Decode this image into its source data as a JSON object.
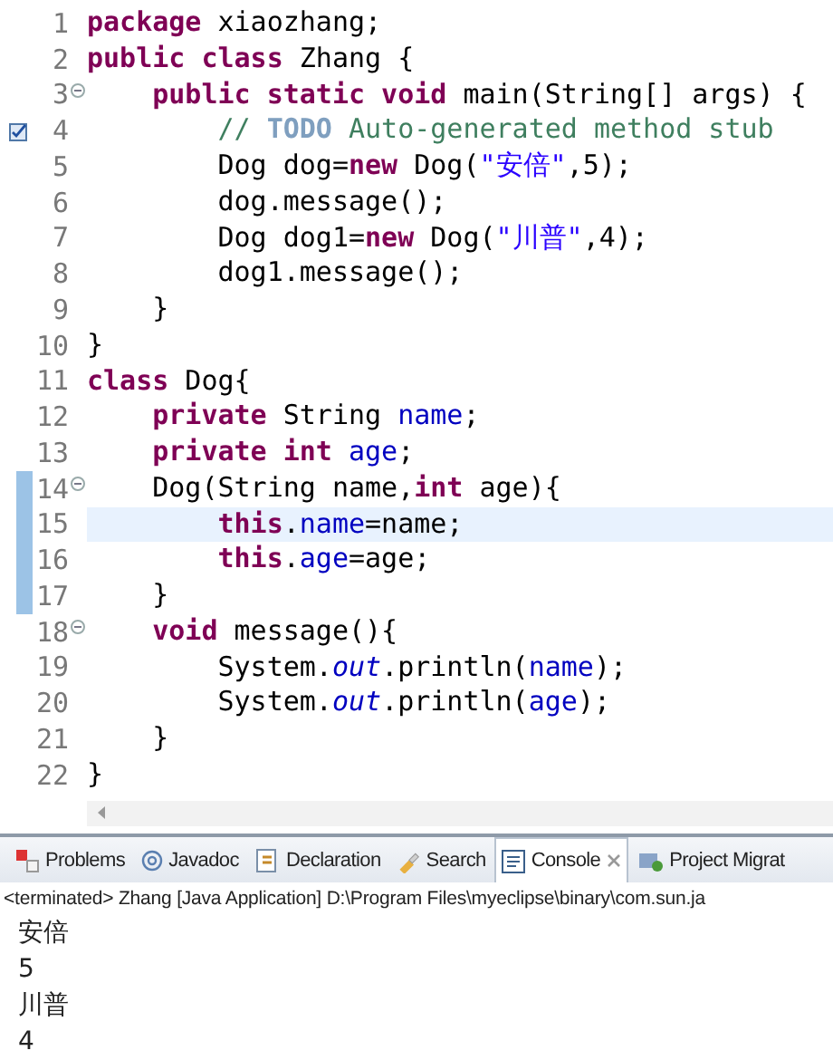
{
  "editor": {
    "lines": [
      {
        "number": "1",
        "fold": false,
        "task": false,
        "changed": false,
        "current": false,
        "tokens": [
          {
            "kind": "keyword",
            "text": "package"
          },
          {
            "kind": "plain",
            "text": " xiaozhang;"
          }
        ]
      },
      {
        "number": "2",
        "fold": false,
        "task": false,
        "changed": false,
        "current": false,
        "tokens": [
          {
            "kind": "keyword",
            "text": "public class"
          },
          {
            "kind": "plain",
            "text": " Zhang {"
          }
        ]
      },
      {
        "number": "3",
        "fold": true,
        "task": false,
        "changed": false,
        "current": false,
        "tokens": [
          {
            "kind": "keyword",
            "text": "    public static void"
          },
          {
            "kind": "plain",
            "text": " main(String[] args) {"
          }
        ]
      },
      {
        "number": "4",
        "fold": false,
        "task": true,
        "changed": false,
        "current": false,
        "tokens": [
          {
            "kind": "comment",
            "text": "        // "
          },
          {
            "kind": "todo",
            "text": "TODO"
          },
          {
            "kind": "comment",
            "text": " Auto-generated method stub"
          }
        ]
      },
      {
        "number": "5",
        "fold": false,
        "task": false,
        "changed": false,
        "current": false,
        "tokens": [
          {
            "kind": "plain",
            "text": "        Dog dog="
          },
          {
            "kind": "keyword",
            "text": "new"
          },
          {
            "kind": "plain",
            "text": " Dog("
          },
          {
            "kind": "string",
            "text": "\"安倍\""
          },
          {
            "kind": "plain",
            "text": ",5);"
          }
        ]
      },
      {
        "number": "6",
        "fold": false,
        "task": false,
        "changed": false,
        "current": false,
        "tokens": [
          {
            "kind": "plain",
            "text": "        dog.message();"
          }
        ]
      },
      {
        "number": "7",
        "fold": false,
        "task": false,
        "changed": false,
        "current": false,
        "tokens": [
          {
            "kind": "plain",
            "text": "        Dog dog1="
          },
          {
            "kind": "keyword",
            "text": "new"
          },
          {
            "kind": "plain",
            "text": " Dog("
          },
          {
            "kind": "string",
            "text": "\"川普\""
          },
          {
            "kind": "plain",
            "text": ",4);"
          }
        ]
      },
      {
        "number": "8",
        "fold": false,
        "task": false,
        "changed": false,
        "current": false,
        "tokens": [
          {
            "kind": "plain",
            "text": "        dog1.message();"
          }
        ]
      },
      {
        "number": "9",
        "fold": false,
        "task": false,
        "changed": false,
        "current": false,
        "tokens": [
          {
            "kind": "plain",
            "text": "    }"
          }
        ]
      },
      {
        "number": "10",
        "fold": false,
        "task": false,
        "changed": false,
        "current": false,
        "tokens": [
          {
            "kind": "plain",
            "text": "}"
          }
        ]
      },
      {
        "number": "11",
        "fold": false,
        "task": false,
        "changed": false,
        "current": false,
        "tokens": [
          {
            "kind": "keyword",
            "text": "class"
          },
          {
            "kind": "plain",
            "text": " Dog{"
          }
        ]
      },
      {
        "number": "12",
        "fold": false,
        "task": false,
        "changed": false,
        "current": false,
        "tokens": [
          {
            "kind": "keyword",
            "text": "    private"
          },
          {
            "kind": "plain",
            "text": " String "
          },
          {
            "kind": "field",
            "text": "name"
          },
          {
            "kind": "plain",
            "text": ";"
          }
        ]
      },
      {
        "number": "13",
        "fold": false,
        "task": false,
        "changed": false,
        "current": false,
        "tokens": [
          {
            "kind": "keyword",
            "text": "    private int "
          },
          {
            "kind": "field",
            "text": "age"
          },
          {
            "kind": "plain",
            "text": ";"
          }
        ]
      },
      {
        "number": "14",
        "fold": true,
        "task": false,
        "changed": true,
        "current": false,
        "tokens": [
          {
            "kind": "plain",
            "text": "    Dog(String name,"
          },
          {
            "kind": "keyword",
            "text": "int"
          },
          {
            "kind": "plain",
            "text": " age){"
          }
        ]
      },
      {
        "number": "15",
        "fold": false,
        "task": false,
        "changed": true,
        "current": true,
        "tokens": [
          {
            "kind": "keyword",
            "text": "        this"
          },
          {
            "kind": "plain",
            "text": "."
          },
          {
            "kind": "field",
            "text": "name"
          },
          {
            "kind": "plain",
            "text": "=name;"
          }
        ]
      },
      {
        "number": "16",
        "fold": false,
        "task": false,
        "changed": true,
        "current": false,
        "tokens": [
          {
            "kind": "keyword",
            "text": "        this"
          },
          {
            "kind": "plain",
            "text": "."
          },
          {
            "kind": "field",
            "text": "age"
          },
          {
            "kind": "plain",
            "text": "=age;"
          }
        ]
      },
      {
        "number": "17",
        "fold": false,
        "task": false,
        "changed": true,
        "current": false,
        "tokens": [
          {
            "kind": "plain",
            "text": "    }"
          }
        ]
      },
      {
        "number": "18",
        "fold": true,
        "task": false,
        "changed": false,
        "current": false,
        "tokens": [
          {
            "kind": "keyword",
            "text": "    void"
          },
          {
            "kind": "plain",
            "text": " message(){"
          }
        ]
      },
      {
        "number": "19",
        "fold": false,
        "task": false,
        "changed": false,
        "current": false,
        "tokens": [
          {
            "kind": "plain",
            "text": "        System."
          },
          {
            "kind": "static",
            "text": "out"
          },
          {
            "kind": "plain",
            "text": ".println("
          },
          {
            "kind": "field",
            "text": "name"
          },
          {
            "kind": "plain",
            "text": ");"
          }
        ]
      },
      {
        "number": "20",
        "fold": false,
        "task": false,
        "changed": false,
        "current": false,
        "tokens": [
          {
            "kind": "plain",
            "text": "        System."
          },
          {
            "kind": "static",
            "text": "out"
          },
          {
            "kind": "plain",
            "text": ".println("
          },
          {
            "kind": "field",
            "text": "age"
          },
          {
            "kind": "plain",
            "text": ");"
          }
        ]
      },
      {
        "number": "21",
        "fold": false,
        "task": false,
        "changed": false,
        "current": false,
        "tokens": [
          {
            "kind": "plain",
            "text": "    }"
          }
        ]
      },
      {
        "number": "22",
        "fold": false,
        "task": false,
        "changed": false,
        "current": false,
        "tokens": [
          {
            "kind": "plain",
            "text": "}"
          }
        ]
      }
    ]
  },
  "panel": {
    "tabs": [
      {
        "label": "Problems",
        "kind": "problems",
        "selected": false
      },
      {
        "label": "Javadoc",
        "kind": "javadoc",
        "selected": false
      },
      {
        "label": "Declaration",
        "kind": "declaration",
        "selected": false
      },
      {
        "label": "Search",
        "kind": "search",
        "selected": false
      },
      {
        "label": "Console",
        "kind": "console",
        "selected": true
      },
      {
        "label": "Project Migrat",
        "kind": "migration",
        "selected": false
      }
    ],
    "console": {
      "header": "<terminated> Zhang [Java Application] D:\\Program Files\\myeclipse\\binary\\com.sun.ja",
      "output": [
        "安倍",
        "5",
        "川普",
        "4"
      ]
    }
  }
}
